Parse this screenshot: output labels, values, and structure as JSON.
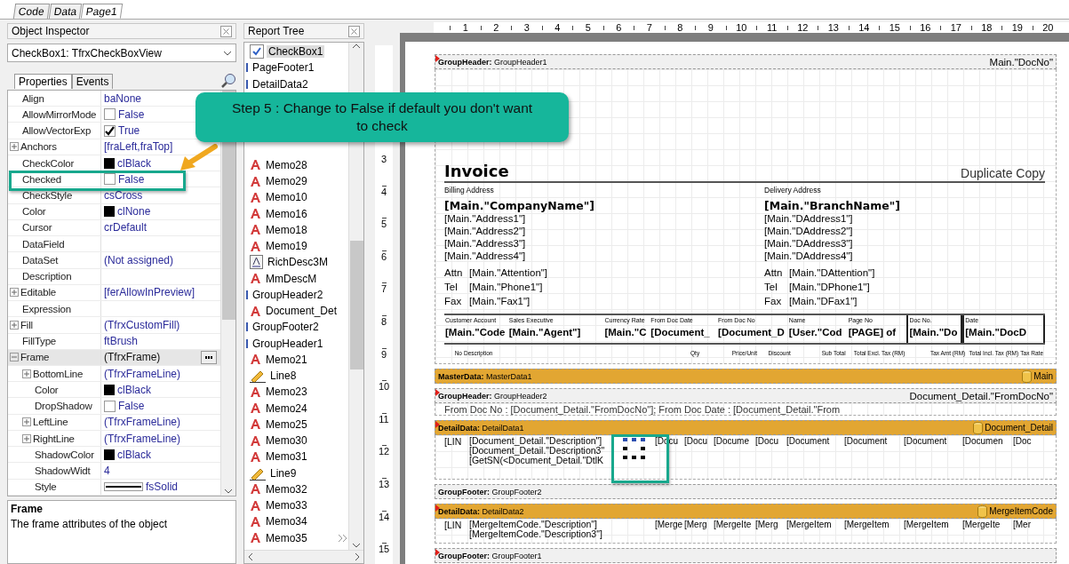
{
  "file_tabs": [
    {
      "label": "Code",
      "selected": false
    },
    {
      "label": "Data",
      "selected": false
    },
    {
      "label": "Page1",
      "selected": true
    }
  ],
  "object_inspector": {
    "title": "Object Inspector",
    "object_select": "CheckBox1: TfrxCheckBoxView",
    "tabs": [
      {
        "label": "Properties",
        "selected": true
      },
      {
        "label": "Events",
        "selected": false
      }
    ],
    "properties": [
      {
        "name": "Align",
        "value": "baNone",
        "kind": "text",
        "selected": false
      },
      {
        "name": "AllowMirrorMode",
        "value": "False",
        "kind": "check",
        "checked": false,
        "selected": false
      },
      {
        "name": "AllowVectorExp",
        "value": "True",
        "kind": "check",
        "checked": true,
        "selected": false
      },
      {
        "name": "Anchors",
        "value": "[fraLeft,fraTop]",
        "kind": "text",
        "expanded": false,
        "selected": false
      },
      {
        "name": "CheckColor",
        "value": "clBlack",
        "kind": "color",
        "selected": false
      },
      {
        "name": "Checked",
        "value": "False",
        "kind": "check",
        "checked": false,
        "selected": false
      },
      {
        "name": "CheckStyle",
        "value": "csCross",
        "kind": "text",
        "selected": false
      },
      {
        "name": "Color",
        "value": "clNone",
        "kind": "color",
        "selected": false
      },
      {
        "name": "Cursor",
        "value": "crDefault",
        "kind": "text",
        "selected": false
      },
      {
        "name": "DataField",
        "kind": "text",
        "selected": false
      },
      {
        "name": "DataSet",
        "value": "(Not assigned)",
        "kind": "text",
        "selected": false
      },
      {
        "name": "Description",
        "kind": "text",
        "selected": false
      },
      {
        "name": "Editable",
        "value": "[ferAllowInPreview]",
        "kind": "text",
        "expanded": false,
        "selected": false
      },
      {
        "name": "Expression",
        "kind": "text",
        "selected": false
      },
      {
        "name": "Fill",
        "value": "(TfrxCustomFill)",
        "kind": "text",
        "expanded": false,
        "selected": false
      },
      {
        "name": "FillType",
        "value": "ftBrush",
        "kind": "text",
        "selected": false
      },
      {
        "name": "Frame",
        "value": "(TfrxFrame)",
        "kind": "dialog",
        "expanded": true,
        "selected": true,
        "children": [
          {
            "name": "BottomLine",
            "value": "(TfrxFrameLine)",
            "kind": "text",
            "expanded": false,
            "selected": false
          },
          {
            "name": "Color",
            "value": "clBlack",
            "kind": "color",
            "selected": false
          },
          {
            "name": "DropShadow",
            "value": "False",
            "kind": "check",
            "checked": false,
            "selected": false
          },
          {
            "name": "LeftLine",
            "value": "(TfrxFrameLine)",
            "kind": "text",
            "expanded": false,
            "selected": false
          },
          {
            "name": "RightLine",
            "value": "(TfrxFrameLine)",
            "kind": "text",
            "expanded": false,
            "selected": false
          },
          {
            "name": "ShadowColor",
            "value": "clBlack",
            "kind": "color",
            "selected": false
          },
          {
            "name": "ShadowWidt",
            "value": "4",
            "kind": "text",
            "selected": false
          },
          {
            "name": "Style",
            "value": "fsSolid",
            "kind": "line",
            "selected": false
          }
        ]
      }
    ],
    "description": {
      "title": "Frame",
      "text": "The frame attributes of the object"
    }
  },
  "report_tree": {
    "title": "Report Tree",
    "items": [
      {
        "label": "CheckBox1",
        "kind": "checkbox",
        "selected": true
      },
      {
        "label": "PageFooter1",
        "kind": "band",
        "selected": false
      },
      {
        "label": "DetailData2",
        "kind": "band",
        "selected": false
      },
      {
        "label": "Memo28",
        "kind": "memo",
        "selected": false
      },
      {
        "label": "Memo29",
        "kind": "memo",
        "selected": false
      },
      {
        "label": "Memo10",
        "kind": "memo",
        "selected": false
      },
      {
        "label": "Memo16",
        "kind": "memo",
        "selected": false
      },
      {
        "label": "Memo18",
        "kind": "memo",
        "selected": false
      },
      {
        "label": "Memo19",
        "kind": "memo",
        "selected": false
      },
      {
        "label": "RichDesc3M",
        "kind": "rich",
        "selected": false
      },
      {
        "label": "MmDescM",
        "kind": "memo",
        "selected": false
      },
      {
        "label": "GroupHeader2",
        "kind": "band",
        "selected": false
      },
      {
        "label": "Document_Det",
        "kind": "memo",
        "selected": false
      },
      {
        "label": "GroupFooter2",
        "kind": "band",
        "selected": false
      },
      {
        "label": "GroupHeader1",
        "kind": "band",
        "selected": false
      },
      {
        "label": "Memo21",
        "kind": "memo",
        "selected": false
      },
      {
        "label": "Line8",
        "kind": "line",
        "selected": false
      },
      {
        "label": "Memo23",
        "kind": "memo",
        "selected": false
      },
      {
        "label": "Memo24",
        "kind": "memo",
        "selected": false
      },
      {
        "label": "Memo25",
        "kind": "memo",
        "selected": false
      },
      {
        "label": "Memo30",
        "kind": "memo",
        "selected": false
      },
      {
        "label": "Memo31",
        "kind": "memo",
        "selected": false
      },
      {
        "label": "Line9",
        "kind": "line",
        "selected": false
      },
      {
        "label": "Memo32",
        "kind": "memo",
        "selected": false
      },
      {
        "label": "Memo33",
        "kind": "memo",
        "selected": false
      },
      {
        "label": "Memo34",
        "kind": "memo",
        "selected": false
      },
      {
        "label": "Memo35",
        "kind": "memo",
        "selected": false
      }
    ]
  },
  "h_ruler": [
    "1",
    "2",
    "3",
    "4",
    "5",
    "6",
    "7",
    "8",
    "9",
    "10",
    "11",
    "12",
    "13",
    "14",
    "15",
    "16",
    "17",
    "18",
    "19",
    "20"
  ],
  "v_ruler": [
    "3",
    "4",
    "5",
    "6",
    "7",
    "8",
    "9",
    "10",
    "11",
    "12",
    "13",
    "14",
    "15"
  ],
  "bands": [
    {
      "kind": "header",
      "title": "**GroupHeader:** GroupHeader1",
      "source": "Main.\"DocNo\"",
      "marked": true,
      "invoice": true
    },
    {
      "kind": "data",
      "title": "**MasterData:** MasterData1",
      "source": "Main",
      "marked": false
    },
    {
      "kind": "header",
      "title": "**GroupHeader:** GroupHeader2",
      "source": "Document_Detail.\"FromDocNo\"",
      "marked": true,
      "text": "From Doc No : [Document_Detail.\"FromDocNo\"];    From Doc Date : [Document_Detail.\"From"
    },
    {
      "kind": "data",
      "title": "**DetailData:** DetailData1",
      "source": "Document_Detail",
      "marked": true,
      "line_no": "[LIN",
      "lines": [
        "[Document_Detail.\"Description\"]",
        "[Document_Detail.\"Description3\"",
        "[GetSN(<Document_Detail.\"DtlK"
      ],
      "checkbox": true,
      "cells": [
        "[Docu",
        "[Docu",
        "[Docume",
        "[Docu",
        "[Document",
        "[Document",
        "[Document",
        "[Documen",
        "[Doc"
      ]
    },
    {
      "kind": "footer",
      "title": "**GroupFooter:** GroupFooter2",
      "marked": false
    },
    {
      "kind": "data",
      "title": "**DetailData:** DetailData2",
      "source": "MergeItemCode",
      "marked": true,
      "line_no": "[LIN",
      "lines": [
        "[MergeItemCode.\"Description\"]",
        "[MergeItemCode.\"Description3\"]"
      ],
      "checkbox": false,
      "cells": [
        "[Merge",
        "[Merg",
        "[MergeIte",
        "[Merg",
        "[MergeItem",
        "[MergeItem",
        "[MergeItem",
        "[MergeIte",
        "[Mer"
      ]
    },
    {
      "kind": "footer",
      "title": "**GroupFooter:** GroupFooter1",
      "marked": true
    }
  ],
  "invoice": {
    "title": "Invoice",
    "copy_label": "Duplicate Copy",
    "addresses": [
      {
        "heading": "Billing Address",
        "name": "[Main.\"CompanyName\"]",
        "lines": [
          "[Main.\"Address1\"]",
          "[Main.\"Address2\"]",
          "[Main.\"Address3\"]",
          "[Main.\"Address4\"]"
        ],
        "contacts": [
          {
            "label": "Attn",
            "value": "[Main.\"Attention\"]"
          },
          {
            "label": "Tel",
            "value": "[Main.\"Phone1\"]"
          },
          {
            "label": "Fax",
            "value": "[Main.\"Fax1\"]"
          }
        ]
      },
      {
        "heading": "Delivery Address",
        "name": "[Main.\"BranchName\"]",
        "lines": [
          "[Main.\"DAddress1\"]",
          "[Main.\"DAddress2\"]",
          "[Main.\"DAddress3\"]",
          "[Main.\"DAddress4\"]"
        ],
        "contacts": [
          {
            "label": "Attn",
            "value": "[Main.\"DAttention\"]"
          },
          {
            "label": "Tel",
            "value": "[Main.\"DPhone1\"]"
          },
          {
            "label": "Fax",
            "value": "[Main.\"DFax1\"]"
          }
        ]
      }
    ],
    "info_columns": [
      {
        "heading": "Customer Account",
        "value": "[Main.\"Code",
        "boxed": false
      },
      {
        "heading": "Sales Executive",
        "value": "[Main.\"Agent\"]",
        "boxed": false
      },
      {
        "heading": "Currency Rate",
        "value": "[Main.\"C",
        "boxed": false
      },
      {
        "heading": "From Doc Date",
        "value": "[Document_",
        "boxed": false
      },
      {
        "heading": "From Doc No",
        "value": "[Document_D",
        "boxed": false
      },
      {
        "heading": "Name",
        "value": "[User.\"Cod",
        "boxed": false
      },
      {
        "heading": "Page No",
        "value": "[PAGE] of",
        "boxed": false
      },
      {
        "heading": "Doc No.",
        "value": "[Main.\"Do",
        "boxed": true
      },
      {
        "heading": "Date",
        "value": "[Main.\"DocD",
        "boxed": true
      }
    ],
    "item_columns": [
      "No",
      "Description",
      "Qty",
      "Price/Unit",
      "Discount",
      "Sub Total",
      "Total Excl. Tax (RM)",
      "Tax Amt (RM)",
      "Total Incl. Tax (RM)",
      "Tax Rate"
    ]
  },
  "callout": {
    "text": "Step 5 : Change to False if default you don't want to check"
  }
}
